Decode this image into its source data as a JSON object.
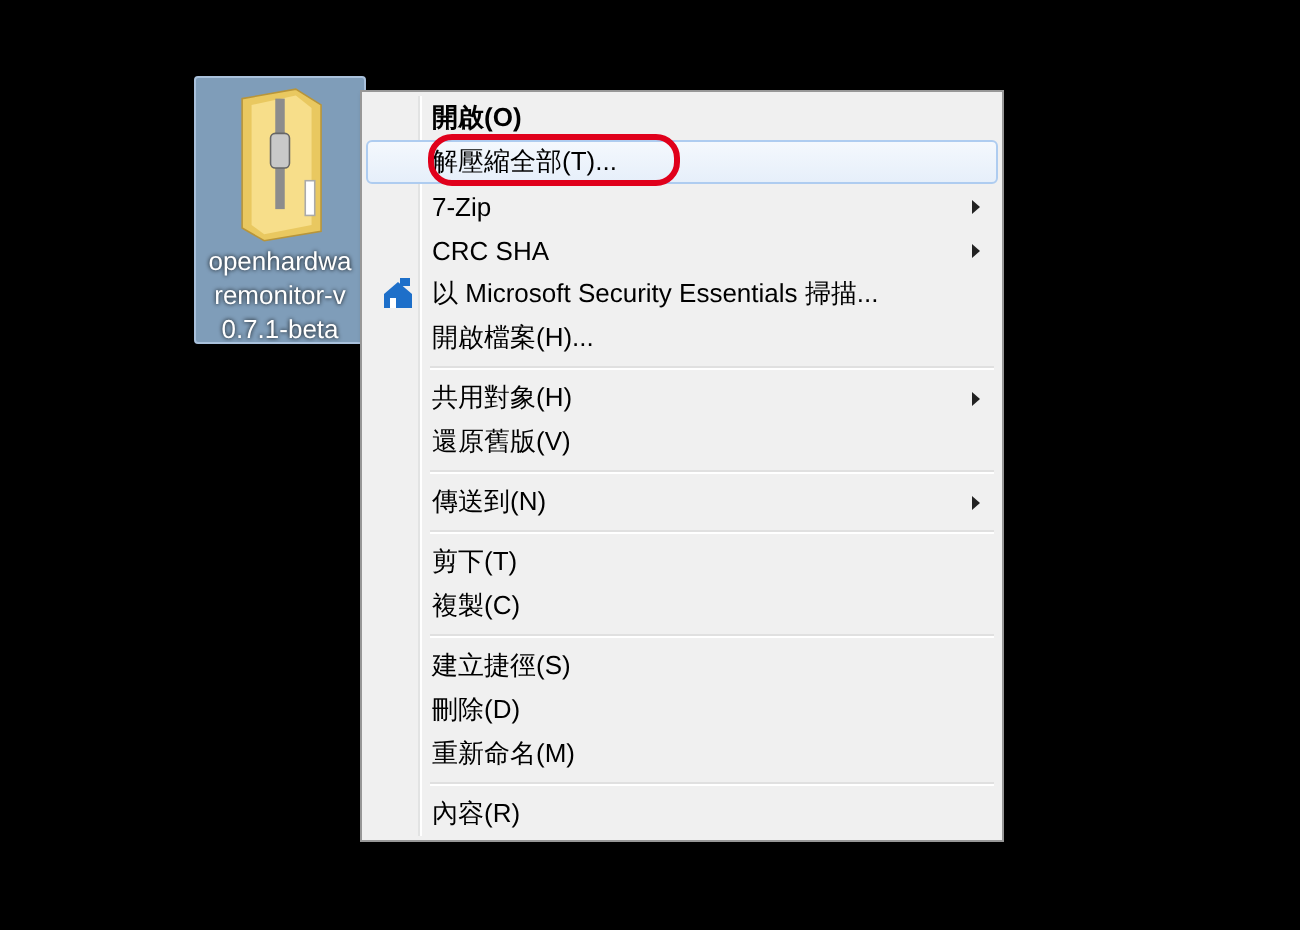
{
  "desktop_icon": {
    "label_lines": [
      "openhardwa",
      "remonitor-v",
      "0.7.1-beta"
    ],
    "selected": true
  },
  "context_menu": {
    "groups": [
      {
        "items": [
          {
            "label": "開啟(O)",
            "bold": true,
            "submenu": false,
            "selected": false,
            "annotated": false,
            "has_icon": false
          },
          {
            "label": "解壓縮全部(T)...",
            "bold": false,
            "submenu": false,
            "selected": true,
            "annotated": true,
            "has_icon": false
          },
          {
            "label": "7-Zip",
            "bold": false,
            "submenu": true,
            "selected": false,
            "annotated": false,
            "has_icon": false
          },
          {
            "label": "CRC SHA",
            "bold": false,
            "submenu": true,
            "selected": false,
            "annotated": false,
            "has_icon": false
          },
          {
            "label": "以 Microsoft Security Essentials 掃描...",
            "bold": false,
            "submenu": false,
            "selected": false,
            "annotated": false,
            "has_icon": true
          },
          {
            "label": "開啟檔案(H)...",
            "bold": false,
            "submenu": false,
            "selected": false,
            "annotated": false,
            "has_icon": false
          }
        ]
      },
      {
        "items": [
          {
            "label": "共用對象(H)",
            "bold": false,
            "submenu": true,
            "selected": false,
            "annotated": false,
            "has_icon": false
          },
          {
            "label": "還原舊版(V)",
            "bold": false,
            "submenu": false,
            "selected": false,
            "annotated": false,
            "has_icon": false
          }
        ]
      },
      {
        "items": [
          {
            "label": "傳送到(N)",
            "bold": false,
            "submenu": true,
            "selected": false,
            "annotated": false,
            "has_icon": false
          }
        ]
      },
      {
        "items": [
          {
            "label": "剪下(T)",
            "bold": false,
            "submenu": false,
            "selected": false,
            "annotated": false,
            "has_icon": false
          },
          {
            "label": "複製(C)",
            "bold": false,
            "submenu": false,
            "selected": false,
            "annotated": false,
            "has_icon": false
          }
        ]
      },
      {
        "items": [
          {
            "label": "建立捷徑(S)",
            "bold": false,
            "submenu": false,
            "selected": false,
            "annotated": false,
            "has_icon": false
          },
          {
            "label": "刪除(D)",
            "bold": false,
            "submenu": false,
            "selected": false,
            "annotated": false,
            "has_icon": false
          },
          {
            "label": "重新命名(M)",
            "bold": false,
            "submenu": false,
            "selected": false,
            "annotated": false,
            "has_icon": false
          }
        ]
      },
      {
        "items": [
          {
            "label": "內容(R)",
            "bold": false,
            "submenu": false,
            "selected": false,
            "annotated": false,
            "has_icon": false
          }
        ]
      }
    ]
  }
}
